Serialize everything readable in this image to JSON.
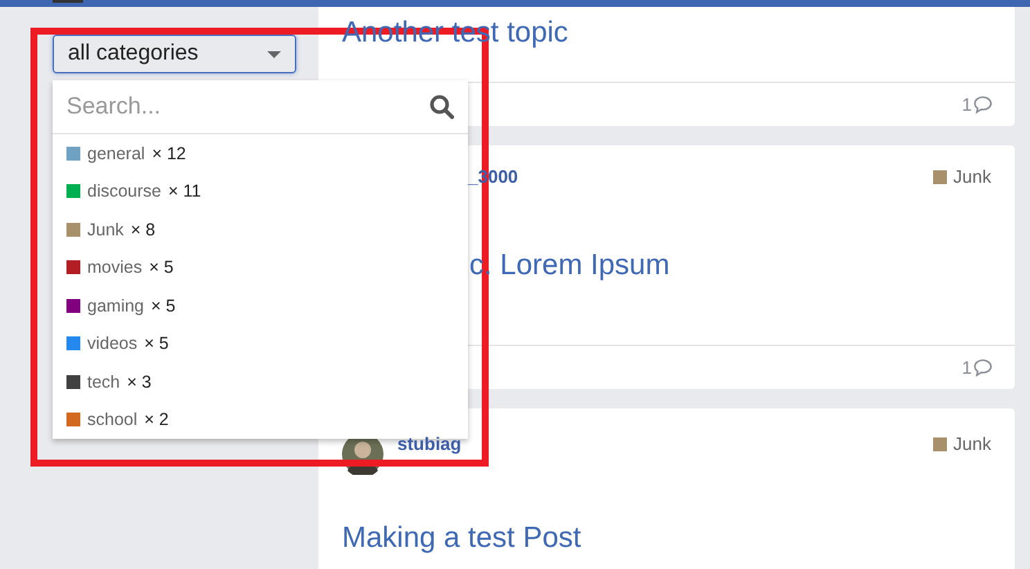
{
  "category_filter": {
    "label": "all categories",
    "expanded": true,
    "search": {
      "placeholder": "Search..."
    },
    "items": [
      {
        "name": "general",
        "count": "× 12",
        "color": "#6fa1c2"
      },
      {
        "name": "discourse",
        "count": "× 11",
        "color": "#00b050"
      },
      {
        "name": "Junk",
        "count": "× 8",
        "color": "#a8916a"
      },
      {
        "name": "movies",
        "count": "× 5",
        "color": "#b21e23"
      },
      {
        "name": "gaming",
        "count": "× 5",
        "color": "#800080"
      },
      {
        "name": "videos",
        "count": "× 5",
        "color": "#2588ec"
      },
      {
        "name": "tech",
        "count": "× 3",
        "color": "#404040"
      },
      {
        "name": "school",
        "count": "× 2",
        "color": "#d2691e"
      }
    ]
  },
  "topics": [
    {
      "kind": "clipped",
      "title": "Another test topic",
      "replies": "1"
    },
    {
      "kind": "covered",
      "author": "_3000",
      "category": {
        "name": "Junk",
        "color": "#a8916a"
      },
      "title": "c. Lorem Ipsum",
      "replies": "1"
    },
    {
      "kind": "avatar",
      "author": "stubiag",
      "category": {
        "name": "Junk",
        "color": "#a8916a"
      },
      "title": "Making a test Post"
    }
  ],
  "annotation": {
    "kind": "frame"
  }
}
